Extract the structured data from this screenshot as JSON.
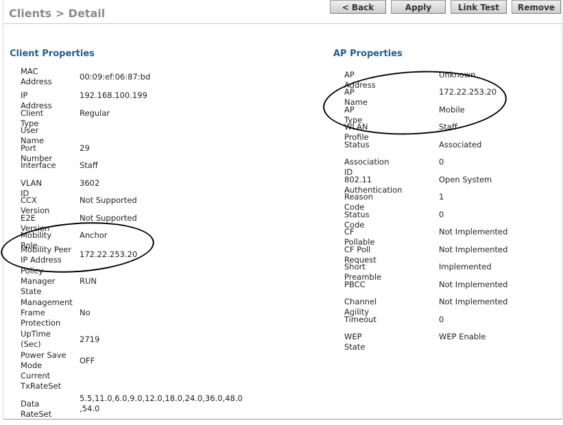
{
  "header": {
    "title": "Clients > Detail",
    "buttons": {
      "back": "< Back",
      "apply": "Apply",
      "link_test": "Link Test",
      "remove": "Remove"
    }
  },
  "client_properties": {
    "title": "Client Properties",
    "rows": [
      {
        "label": "MAC Address",
        "value": "00:09:ef:06:87:bd"
      },
      {
        "label": "IP Address",
        "value": "192.168.100.199"
      },
      {
        "label": "Client Type",
        "value": "Regular"
      },
      {
        "label": "User Name",
        "value": ""
      },
      {
        "label": "Port Number",
        "value": "29"
      },
      {
        "label": "Interface",
        "value": "Staff"
      },
      {
        "label": "VLAN ID",
        "value": "3602"
      },
      {
        "label": "CCX Version",
        "value": "Not Supported"
      },
      {
        "label": "E2E Version",
        "value": "Not Supported"
      },
      {
        "label": "Mobility Role",
        "value": "Anchor"
      },
      {
        "label": "Mobility Peer IP Address",
        "value": "172.22.253.20"
      },
      {
        "label": "Policy Manager State",
        "value": "RUN"
      },
      {
        "label": "Management Frame Protection",
        "value": "No"
      },
      {
        "label": "UpTime (Sec)",
        "value": "2719"
      },
      {
        "label": "Power Save Mode",
        "value": "OFF"
      },
      {
        "label": "Current TxRateSet",
        "value": ""
      },
      {
        "label": "Data RateSet",
        "value": "5.5,11.0,6.0,9.0,12.0,18.0,24.0,36.0,48.0 ,54.0"
      }
    ]
  },
  "ap_properties": {
    "title": "AP Properties",
    "rows": [
      {
        "label": "AP Address",
        "value": "Unknown"
      },
      {
        "label": "AP Name",
        "value": "172.22.253.20"
      },
      {
        "label": "AP Type",
        "value": "Mobile"
      },
      {
        "label": "WLAN Profile",
        "value": "Staff"
      },
      {
        "label": "Status",
        "value": "Associated"
      },
      {
        "label": "Association ID",
        "value": "0"
      },
      {
        "label": "802.11 Authentication",
        "value": "Open System"
      },
      {
        "label": "Reason Code",
        "value": "1"
      },
      {
        "label": "Status Code",
        "value": "0"
      },
      {
        "label": "CF Pollable",
        "value": "Not Implemented"
      },
      {
        "label": "CF Poll Request",
        "value": "Not Implemented"
      },
      {
        "label": "Short Preamble",
        "value": "Implemented"
      },
      {
        "label": "PBCC",
        "value": "Not Implemented"
      },
      {
        "label": "Channel Agility",
        "value": "Not Implemented"
      },
      {
        "label": "Timeout",
        "value": "0"
      },
      {
        "label": "WEP State",
        "value": "WEP Enable"
      }
    ]
  }
}
